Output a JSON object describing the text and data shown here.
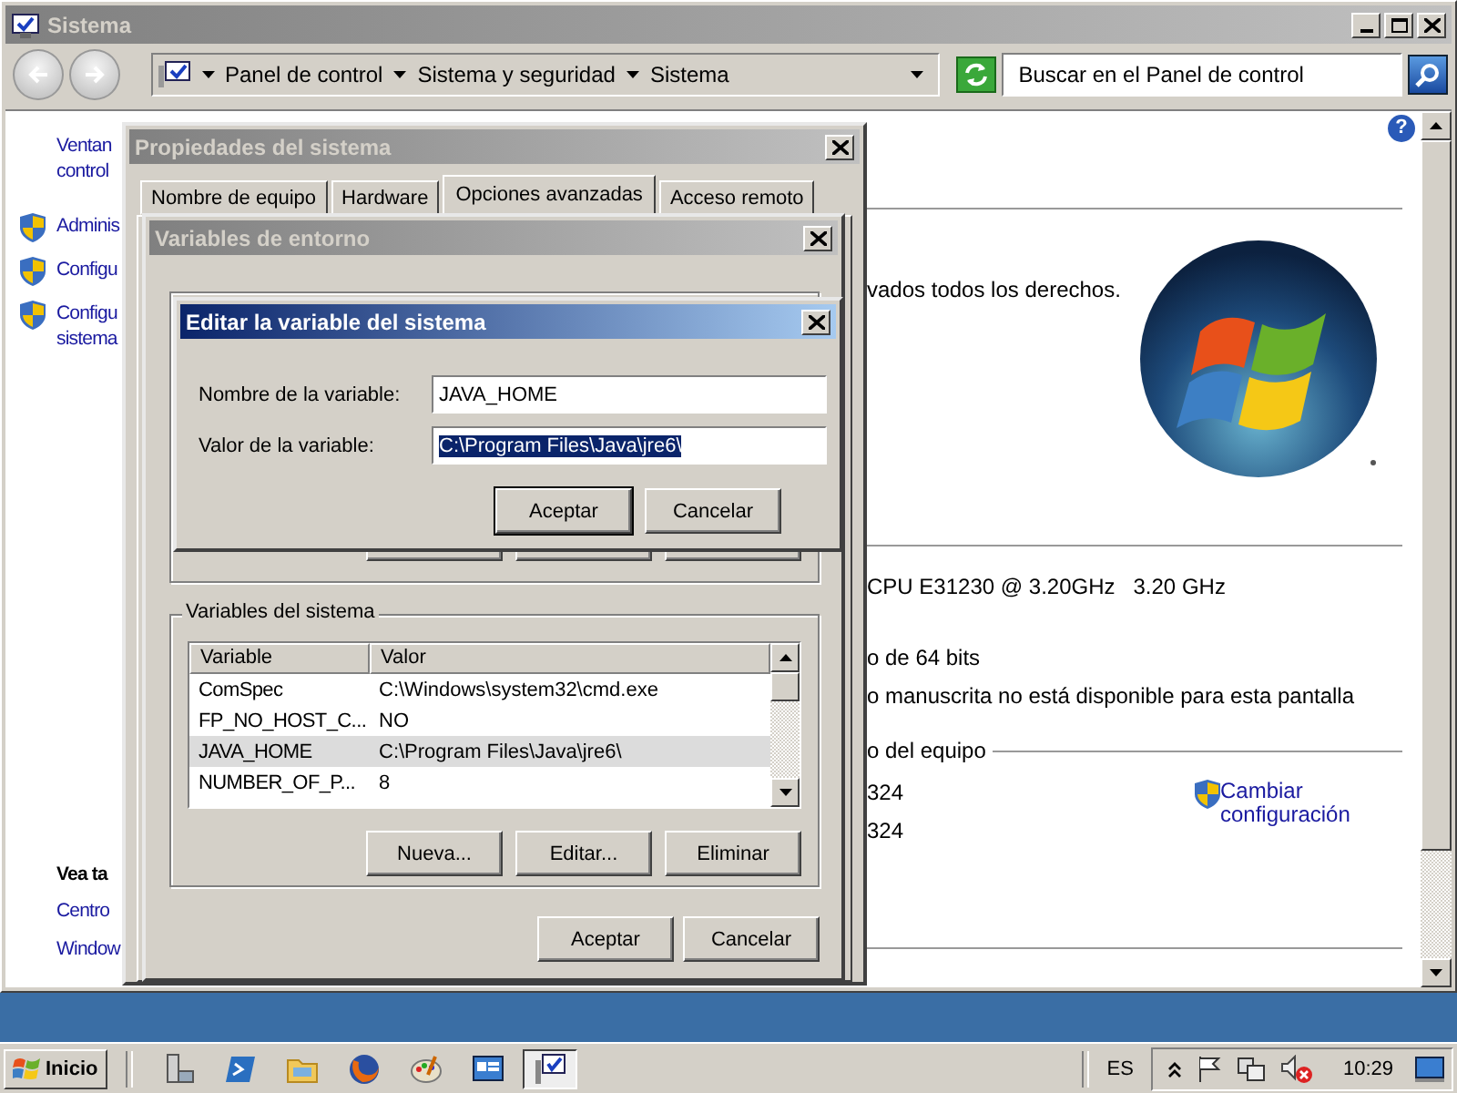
{
  "main_window": {
    "title": "Sistema",
    "breadcrumb": [
      "Panel de control",
      "Sistema y seguridad",
      "Sistema"
    ],
    "search": {
      "placeholder": "Buscar en el Panel de control"
    },
    "help": "?",
    "sidebar": [
      {
        "lines": [
          "Ventan",
          "control"
        ],
        "shield": false
      },
      {
        "lines": [
          "Adminis"
        ],
        "shield": true
      },
      {
        "lines": [
          "Configu"
        ],
        "shield": true
      },
      {
        "lines": [
          "Configu",
          "sistema"
        ],
        "shield": true
      }
    ],
    "see_also": {
      "heading": "Vea ta",
      "links": [
        "Centro",
        "Window"
      ]
    },
    "copyright": "vados todos los derechos.",
    "processor": "CPU E31230 @ 3.20GHz",
    "speed": "3.20 GHz",
    "system_type": "o de 64 bits",
    "pen": "o manuscrita no está disponible para esta pantalla",
    "section": "o del equipo",
    "values": [
      "324",
      "324"
    ],
    "change_link": "Cambiar configuración"
  },
  "system_properties": {
    "title": "Propiedades del sistema",
    "tabs": [
      {
        "label": "Nombre de equipo",
        "selected": false
      },
      {
        "label": "Hardware",
        "selected": false
      },
      {
        "label": "Opciones avanzadas",
        "selected": true
      },
      {
        "label": "Acceso remoto",
        "selected": false
      }
    ]
  },
  "environment_variables": {
    "title": "Variables de entorno",
    "system_group": {
      "label": "Variables del sistema",
      "columns": [
        "Variable",
        "Valor"
      ],
      "rows": [
        {
          "name": "ComSpec",
          "value": "C:\\Windows\\system32\\cmd.exe",
          "selected": false
        },
        {
          "name": "FP_NO_HOST_C...",
          "value": "NO",
          "selected": false
        },
        {
          "name": "JAVA_HOME",
          "value": "C:\\Program Files\\Java\\jre6\\",
          "selected": true
        },
        {
          "name": "NUMBER_OF_P...",
          "value": "8",
          "selected": false
        }
      ],
      "buttons": [
        "Nueva...",
        "Editar...",
        "Eliminar"
      ]
    },
    "buttons": [
      "Aceptar",
      "Cancelar"
    ]
  },
  "edit_dialog": {
    "title": "Editar la variable del sistema",
    "fields": [
      {
        "label": "Nombre de la variable:",
        "value": "JAVA_HOME",
        "selected": false
      },
      {
        "label": "Valor de la variable:",
        "value": "C:\\Program Files\\Java\\jre6\\",
        "selected": true
      }
    ],
    "buttons": [
      {
        "label": "Aceptar",
        "default": true
      },
      {
        "label": "Cancelar",
        "default": false
      }
    ]
  },
  "taskbar": {
    "start": "Inicio",
    "apps": [
      {
        "kind": "server",
        "selected": false
      },
      {
        "kind": "terminal",
        "selected": false
      },
      {
        "kind": "folder",
        "selected": false
      },
      {
        "kind": "globe",
        "selected": false
      },
      {
        "kind": "palette",
        "selected": false
      },
      {
        "kind": "window",
        "selected": false
      },
      {
        "kind": "monitor",
        "selected": true
      }
    ],
    "language": "ES",
    "clock": "10:29"
  }
}
